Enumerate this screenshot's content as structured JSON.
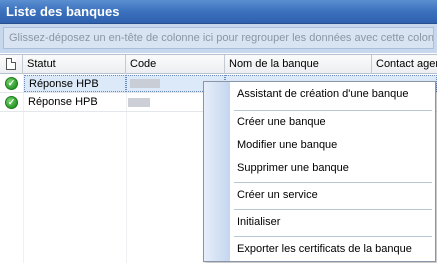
{
  "window": {
    "title": "Liste des banques"
  },
  "groupbar": {
    "text": "Glissez-déposez un en-tête de colonne ici pour regrouper les données avec cette colonne."
  },
  "columns": {
    "status": "Statut",
    "code": "Code",
    "bank_name": "Nom de la banque",
    "contact": "Contact agence"
  },
  "rows": [
    {
      "status": "Réponse HPB",
      "selected": true
    },
    {
      "status": "Réponse HPB",
      "selected": false
    }
  ],
  "context_menu": {
    "items": [
      "Assistant de création d'une banque",
      "Créer une banque",
      "Modifier une banque",
      "Supprimer une banque",
      "Créer un service",
      "Initialiser",
      "Exporter les certificats de la banque"
    ]
  },
  "colors": {
    "title_bar": "#3b70bd",
    "status_ok": "#2a9a2a",
    "selection": "#dce9f9"
  }
}
